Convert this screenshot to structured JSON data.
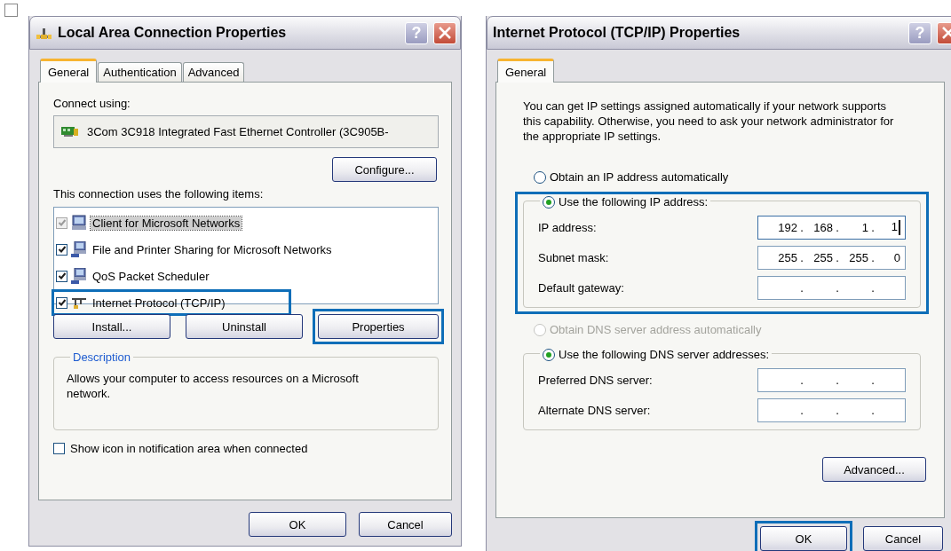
{
  "connection_dialog": {
    "title": "Local Area Connection Properties",
    "help_button": "?",
    "tabs": [
      {
        "label": "General",
        "selected": true
      },
      {
        "label": "Authentication",
        "selected": false
      },
      {
        "label": "Advanced",
        "selected": false
      }
    ],
    "connect_using_label": "Connect using:",
    "adapter": "3Com 3C918 Integrated Fast Ethernet Controller (3C905B-",
    "configure_button": "Configure...",
    "items_label": "This connection uses the following items:",
    "items": [
      {
        "kind": "client",
        "label": "Client for Microsoft Networks",
        "checked": true,
        "disabled": true,
        "selected": true,
        "highlighted": false
      },
      {
        "kind": "service",
        "label": "File and Printer Sharing for Microsoft Networks",
        "checked": true,
        "disabled": false,
        "selected": false,
        "highlighted": false
      },
      {
        "kind": "service",
        "label": "QoS Packet Scheduler",
        "checked": true,
        "disabled": false,
        "selected": false,
        "highlighted": false
      },
      {
        "kind": "protocol",
        "label": "Internet Protocol (TCP/IP)",
        "checked": true,
        "disabled": false,
        "selected": false,
        "highlighted": true
      }
    ],
    "item_buttons": [
      {
        "label": "Install...",
        "highlighted": false
      },
      {
        "label": "Uninstall",
        "highlighted": false
      },
      {
        "label": "Properties",
        "highlighted": true
      }
    ],
    "description": {
      "title": "Description",
      "text": "Allows your computer to access resources on a Microsoft network."
    },
    "notify_option": {
      "label": "Show icon in notification area when connected",
      "checked": false
    },
    "footer_buttons": [
      {
        "label": "OK",
        "highlighted": false
      },
      {
        "label": "Cancel",
        "highlighted": false
      }
    ]
  },
  "tcpip_dialog": {
    "title": "Internet Protocol (TCP/IP) Properties",
    "help_button": "?",
    "tabs": [
      {
        "label": "General",
        "selected": true
      }
    ],
    "intro": "You can get IP settings assigned automatically if your network supports this capability. Otherwise, you need to ask your network administrator for the appropriate IP settings.",
    "ip_sections": [
      {
        "auto_option": {
          "label": "Obtain an IP address automatically",
          "selected": false,
          "disabled": false
        },
        "manual_option": {
          "label": "Use the following IP address:",
          "selected": true
        },
        "highlighted": true,
        "fields": [
          {
            "label": "IP address:",
            "octets": [
              "192",
              "168",
              "1",
              "1"
            ],
            "dots": [
              ".",
              ".",
              "."
            ],
            "focused": true
          },
          {
            "label": "Subnet mask:",
            "octets": [
              "255",
              "255",
              "255",
              "0"
            ],
            "dots": [
              ".",
              ".",
              "."
            ],
            "focused": false
          },
          {
            "label": "Default gateway:",
            "dots": [
              ".",
              ".",
              "."
            ],
            "focused": false
          }
        ]
      },
      {
        "auto_option": {
          "label": "Obtain DNS server address automatically",
          "selected": false,
          "disabled": true
        },
        "manual_option": {
          "label": "Use the following DNS server addresses:",
          "selected": true
        },
        "highlighted": false,
        "fields": [
          {
            "label": "Preferred DNS server:",
            "dots": [
              ".",
              ".",
              "."
            ],
            "focused": false
          },
          {
            "label": "Alternate DNS server:",
            "dots": [
              ".",
              ".",
              "."
            ],
            "focused": false
          }
        ]
      }
    ],
    "advanced_button": "Advanced...",
    "footer_buttons": [
      {
        "label": "OK",
        "highlighted": true
      },
      {
        "label": "Cancel",
        "highlighted": false
      }
    ]
  }
}
